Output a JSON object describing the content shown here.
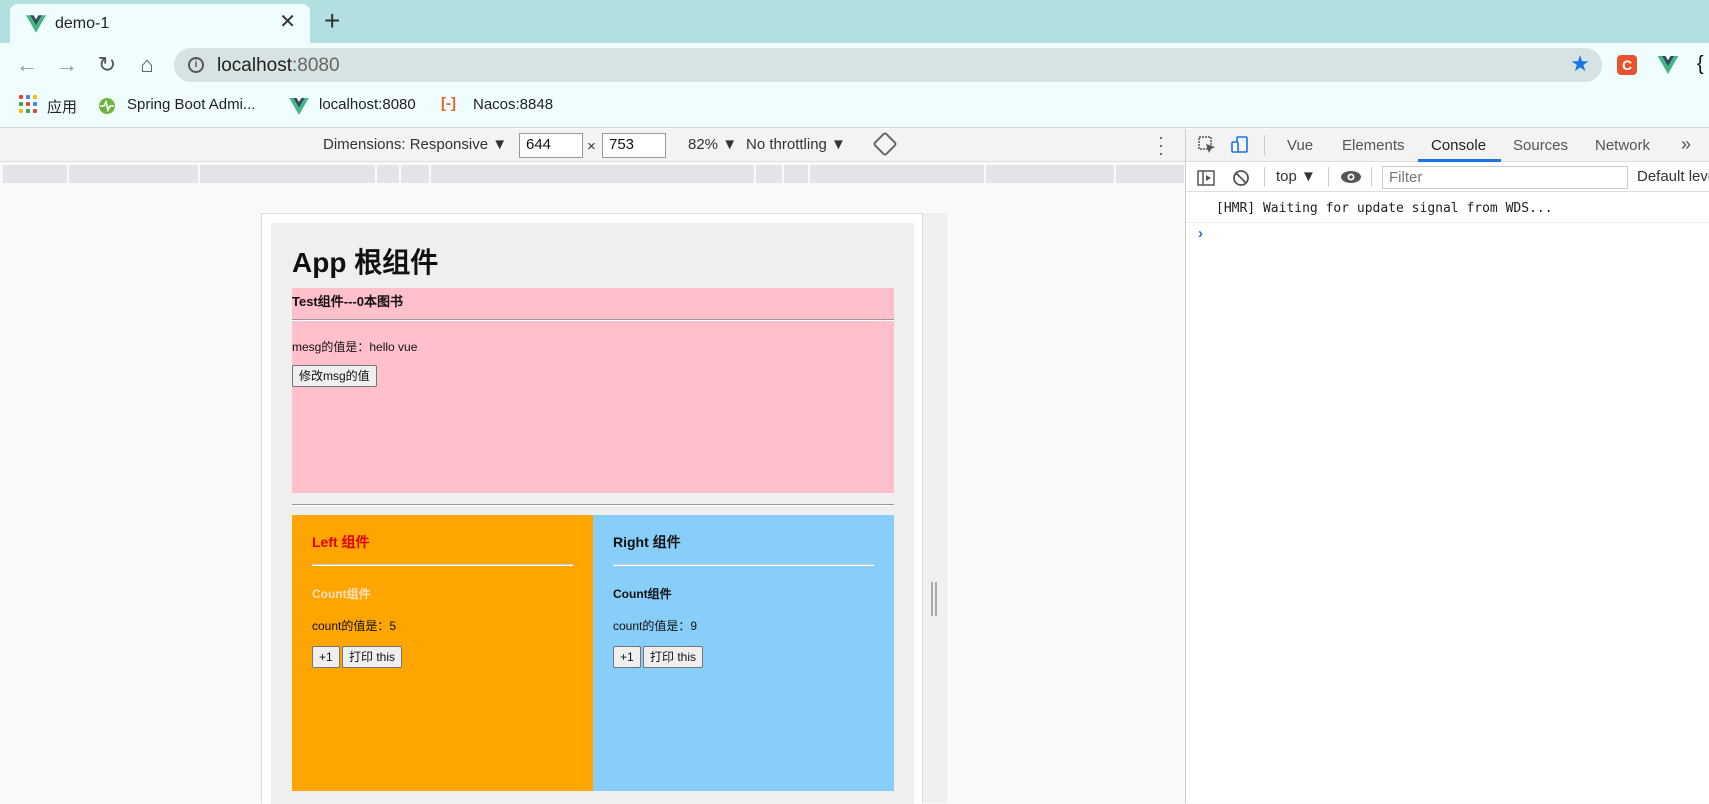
{
  "browser": {
    "tab_title": "demo-1",
    "close_label": "✕",
    "new_tab_label": "+",
    "url_host": "localhost",
    "url_port": ":8080",
    "bookmarks": [
      "应用",
      "Spring Boot Admi...",
      "localhost:8080",
      "Nacos:8848"
    ],
    "accent_color": "#1a73e8",
    "tab_strip_color": "#b2e0e0"
  },
  "device_toolbar": {
    "dimensions_label": "Dimensions: Responsive ▼",
    "width": "644",
    "times": "×",
    "height": "753",
    "zoom": "82% ▼",
    "throttling": "No throttling ▼"
  },
  "app": {
    "title": "App 根组件",
    "test": {
      "title": "Test组件---0本图书",
      "msg_line": "mesg的值是：hello vue",
      "change_button": "修改msg的值",
      "bg_color": "#ffc0cb"
    },
    "left": {
      "title": "Left 组件",
      "count_title": "Count组件",
      "count_line": "count的值是：5",
      "plus_button": "+1",
      "print_button": "打印 this",
      "bg_color": "#ffa500"
    },
    "right": {
      "title": "Right 组件",
      "count_title": "Count组件",
      "count_line": "count的值是：9",
      "plus_button": "+1",
      "print_button": "打印 this",
      "bg_color": "#87cefa"
    }
  },
  "devtools": {
    "tabs": [
      "Vue",
      "Elements",
      "Console",
      "Sources",
      "Network"
    ],
    "more_tabs": "»",
    "active_tab": "Console",
    "context": "top ▼",
    "filter_placeholder": "Filter",
    "levels": "Default leve",
    "messages": [
      "[HMR] Waiting for update signal from WDS..."
    ],
    "prompt": "›"
  }
}
